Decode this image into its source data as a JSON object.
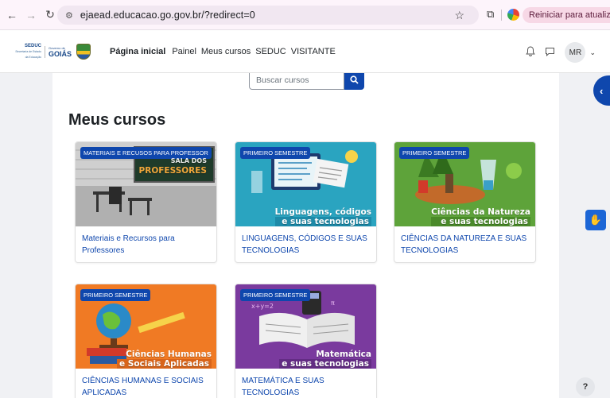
{
  "browser": {
    "url": "ejaead.educacao.go.gov.br/?redirect=0",
    "update_label": "Reiniciar para atualizar"
  },
  "logo": {
    "seduc": "SEDUC",
    "seduc_sub": "Secretaria de Estado da Educação",
    "gov_small": "Governo de",
    "gov_big": "GOIÁS"
  },
  "navbar": {
    "links": [
      "Página inicial",
      "Painel",
      "Meus cursos",
      "SEDUC",
      "VISITANTE"
    ],
    "avatar_initials": "MR"
  },
  "search": {
    "placeholder": "Buscar cursos"
  },
  "page_title": "Meus cursos",
  "courses": [
    {
      "category": "MATERIAIS E RECUSOS PARA PROFESSOR",
      "image_text": [
        "SALA DOS",
        "PROFESSORES"
      ],
      "name": "Materiais e Recursos para Professores",
      "color": "#8a8a8a"
    },
    {
      "category": "PRIMEIRO SEMESTRE",
      "image_text": [
        "Linguagens, códigos",
        "e suas tecnologias"
      ],
      "name": "LINGUAGENS, CÓDIGOS E SUAS TECNOLOGIAS",
      "color": "#2aa4c0"
    },
    {
      "category": "PRIMEIRO SEMESTRE",
      "image_text": [
        "Ciências da Natureza",
        "e suas tecnologias"
      ],
      "name": "CIÊNCIAS DA NATUREZA E SUAS TECNOLOGIAS",
      "color": "#5ea33a"
    },
    {
      "category": "PRIMEIRO SEMESTRE",
      "image_text": [
        "Ciências Humanas",
        "e Sociais Aplicadas"
      ],
      "name": "CIÊNCIAS HUMANAS E SOCIAIS APLICADAS",
      "color": "#f07a24"
    },
    {
      "category": "PRIMEIRO SEMESTRE",
      "image_text": [
        "Matemática",
        "e suas tecnologias"
      ],
      "name": "MATEMÁTICA E SUAS TECNOLOGIAS",
      "color": "#7a3a9e"
    }
  ],
  "colors": {
    "primary": "#0f47ad",
    "page_bg": "#f0f1f4"
  },
  "icons": {
    "back": "arrow-left-icon",
    "forward": "arrow-right-icon",
    "reload": "reload-icon",
    "star": "star-icon",
    "extensions": "puzzle-icon",
    "notifications": "bell-icon",
    "messages": "chat-icon",
    "drawer": "chevron-left-icon",
    "accessibility": "hands-icon",
    "help": "question-icon"
  },
  "help_label": "?"
}
